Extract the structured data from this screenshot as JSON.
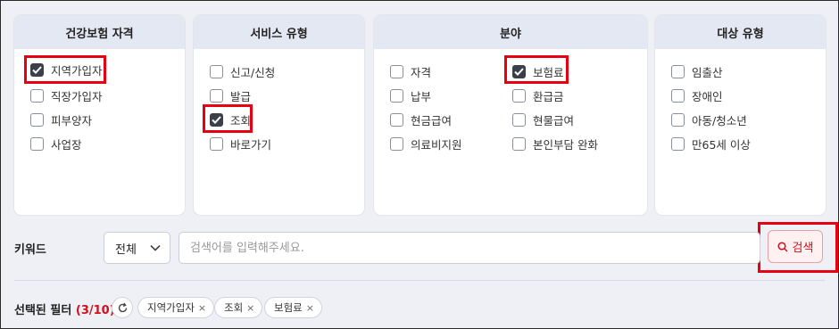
{
  "panels": [
    {
      "title": "건강보험 자격",
      "options": [
        {
          "label": "지역가입자",
          "checked": true
        },
        {
          "label": "직장가입자",
          "checked": false
        },
        {
          "label": "피부양자",
          "checked": false
        },
        {
          "label": "사업장",
          "checked": false
        }
      ]
    },
    {
      "title": "서비스 유형",
      "options": [
        {
          "label": "신고/신청",
          "checked": false
        },
        {
          "label": "발급",
          "checked": false
        },
        {
          "label": "조회",
          "checked": true
        },
        {
          "label": "바로가기",
          "checked": false
        }
      ]
    },
    {
      "title": "분야",
      "options": [
        {
          "label": "자격",
          "checked": false
        },
        {
          "label": "납부",
          "checked": false
        },
        {
          "label": "현금급여",
          "checked": false
        },
        {
          "label": "의료비지원",
          "checked": false
        },
        {
          "label": "보험료",
          "checked": true
        },
        {
          "label": "환급금",
          "checked": false
        },
        {
          "label": "현물급여",
          "checked": false
        },
        {
          "label": "본인부담 완화",
          "checked": false
        }
      ]
    },
    {
      "title": "대상 유형",
      "options": [
        {
          "label": "임출산",
          "checked": false
        },
        {
          "label": "장애인",
          "checked": false
        },
        {
          "label": "아동/청소년",
          "checked": false
        },
        {
          "label": "만65세 이상",
          "checked": false
        }
      ]
    }
  ],
  "keyword": {
    "label": "키워드",
    "scope_value": "전체",
    "placeholder": "검색어를 입력해주세요.",
    "search_label": "검색"
  },
  "selected": {
    "label": "선택된 필터",
    "count_open": "(",
    "count": "3/10",
    "count_close": ")",
    "chips": [
      "지역가입자",
      "조회",
      "보험료"
    ],
    "remove_glyph": "×"
  },
  "colors": {
    "accent": "#e60012",
    "header_bg": "#e4e8f2",
    "checked": "#3b3f4a"
  }
}
